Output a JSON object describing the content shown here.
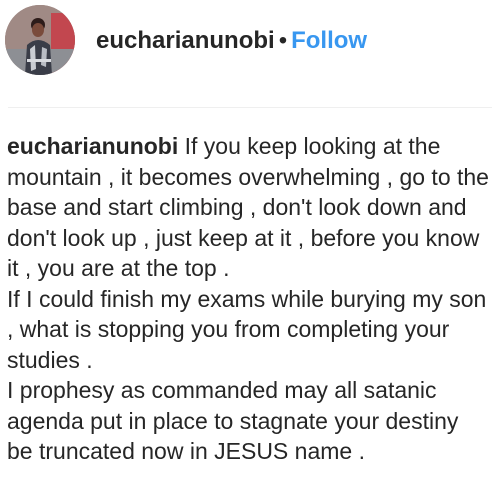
{
  "post": {
    "username": "eucharianunobi",
    "separator": "•",
    "follow_label": "Follow",
    "caption_username": "eucharianunobi",
    "caption_text": " If you keep looking at the mountain , it becomes overwhelming , go to the base and start climbing , don't look down and don't look up , just keep at it , before you know it , you are at the top .\nIf I could finish my exams while burying my son , what is stopping you from completing your studies .\nI prophesy as commanded may all satanic agenda put in place to stagnate your destiny be truncated now in JESUS name ."
  },
  "colors": {
    "text": "#262626",
    "follow": "#3897f0",
    "divider": "#efefef"
  },
  "icons": {
    "avatar": "profile-photo"
  }
}
